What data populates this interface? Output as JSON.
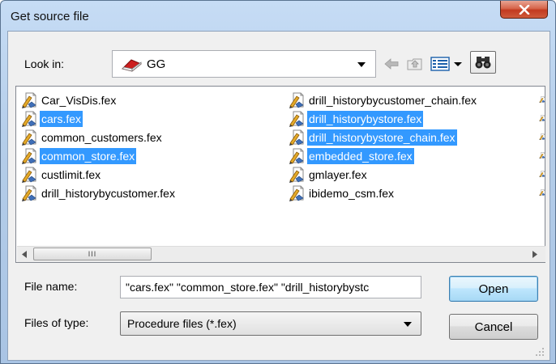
{
  "window": {
    "title": "Get source file"
  },
  "lookin": {
    "label": "Look in:",
    "value": "GG"
  },
  "files": {
    "left": [
      {
        "name": "Car_VisDis.fex",
        "selected": false
      },
      {
        "name": "cars.fex",
        "selected": true
      },
      {
        "name": "common_customers.fex",
        "selected": false
      },
      {
        "name": "common_store.fex",
        "selected": true
      },
      {
        "name": "custlimit.fex",
        "selected": false
      },
      {
        "name": "drill_historybycustomer.fex",
        "selected": false
      }
    ],
    "right": [
      {
        "name": "drill_historybycustomer_chain.fex",
        "selected": false
      },
      {
        "name": "drill_historybystore.fex",
        "selected": true
      },
      {
        "name": "drill_historybystore_chain.fex",
        "selected": true
      },
      {
        "name": "embedded_store.fex",
        "selected": true
      },
      {
        "name": "gmlayer.fex",
        "selected": false
      },
      {
        "name": "ibidemo_csm.fex",
        "selected": false
      }
    ]
  },
  "scrollbar": {
    "thumb_grip": "III"
  },
  "filename": {
    "label": "File name:",
    "value": "\"cars.fex\" \"common_store.fex\" \"drill_historybystc"
  },
  "filetype": {
    "label": "Files of type:",
    "value": "Procedure files (*.fex)"
  },
  "buttons": {
    "open": "Open",
    "cancel": "Cancel"
  },
  "colors": {
    "selection": "#3399ff",
    "title_close": "#c23a1f",
    "dialog_bg": "#f0f0f0"
  }
}
